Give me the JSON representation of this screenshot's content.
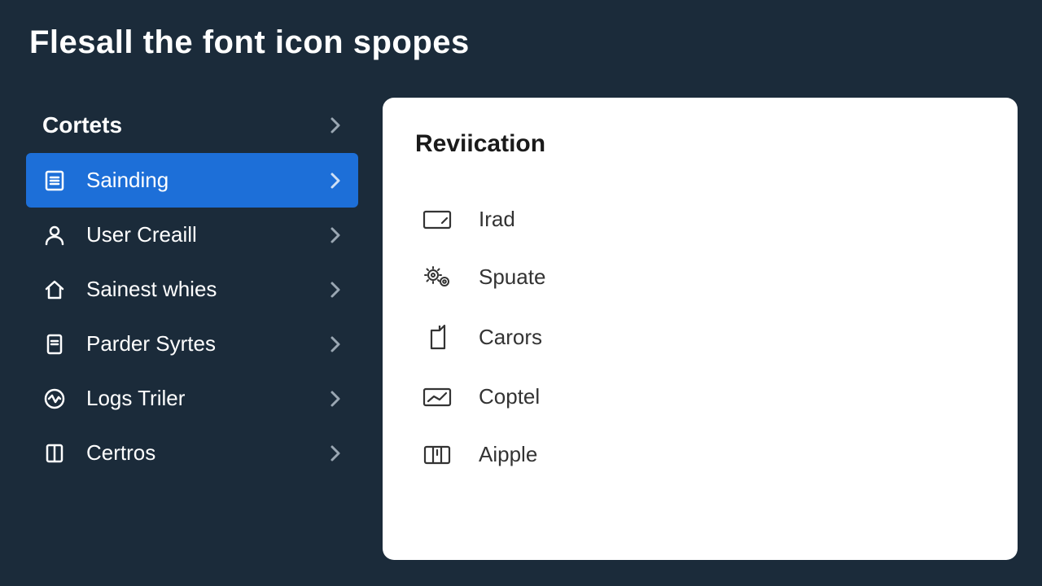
{
  "header": {
    "title": "Flesall the font icon spopes"
  },
  "sidebar": {
    "header_label": "Cortets",
    "items": [
      {
        "label": "Sainding",
        "icon": "list-icon",
        "selected": true
      },
      {
        "label": "User Creaill",
        "icon": "user-icon",
        "selected": false
      },
      {
        "label": "Sainest whies",
        "icon": "home-icon",
        "selected": false
      },
      {
        "label": "Parder Syrtes",
        "icon": "document-icon",
        "selected": false
      },
      {
        "label": "Logs Triler",
        "icon": "activity-icon",
        "selected": false
      },
      {
        "label": "Certros",
        "icon": "package-icon",
        "selected": false
      }
    ]
  },
  "panel": {
    "title": "Reviication",
    "items": [
      {
        "label": "Irad",
        "icon": "tablet-edit-icon"
      },
      {
        "label": "Spuate",
        "icon": "gears-icon"
      },
      {
        "label": "Carors",
        "icon": "file-icon"
      },
      {
        "label": "Coptel",
        "icon": "chart-icon"
      },
      {
        "label": "Aipple",
        "icon": "columns-icon"
      }
    ]
  }
}
